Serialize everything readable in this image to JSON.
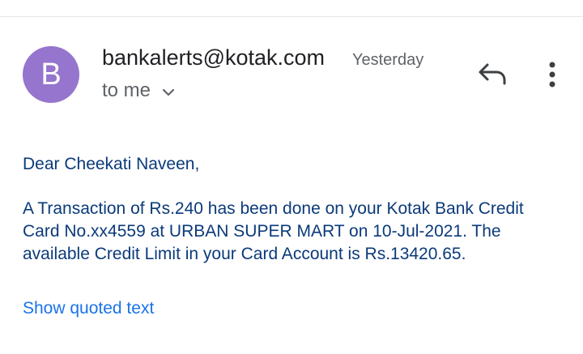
{
  "email": {
    "sender": "bankalerts@kotak.com",
    "avatar_letter": "B",
    "avatar_color": "#9575cd",
    "time": "Yesterday",
    "recipient_label": "to me",
    "greeting": "Dear Cheekati Naveen,",
    "body": "A Transaction of Rs.240 has been done on your Kotak Bank Credit Card No.xx4559 at URBAN SUPER MART on 10-Jul-2021. The available Credit Limit in your Card Account is Rs.13420.65.",
    "show_quoted_label": "Show quoted text"
  },
  "icons": {
    "reply": "reply-icon",
    "more": "more-vert-icon",
    "expand": "chevron-down-icon"
  },
  "colors": {
    "body_text": "#0b3a7a",
    "link": "#1a73e8",
    "secondary_text": "#5f6368"
  }
}
